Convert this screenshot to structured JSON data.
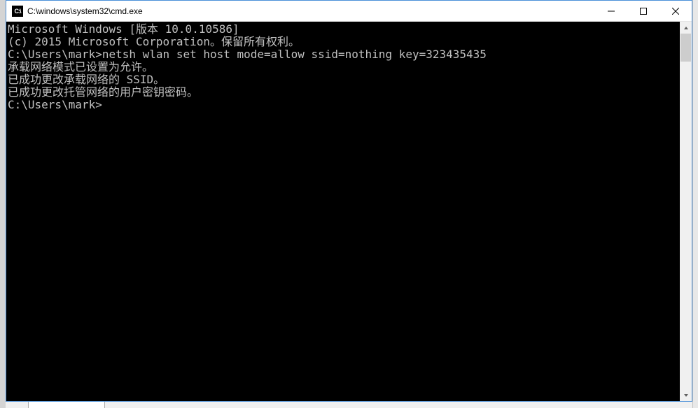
{
  "titlebar": {
    "icon_label": "C:\\",
    "title": "C:\\windows\\system32\\cmd.exe"
  },
  "terminal": {
    "line1": "Microsoft Windows [版本 10.0.10586]",
    "line2": "(c) 2015 Microsoft Corporation。保留所有权利。",
    "blank1": "",
    "prompt1": "C:\\Users\\mark>",
    "command1": "netsh wlan set host mode=allow ssid=nothing key=323435435",
    "resp1": "承载网络模式已设置为允许。",
    "resp2": "已成功更改承载网络的 SSID。",
    "resp3": "已成功更改托管网络的用户密钥密码。",
    "blank2": "",
    "blank3": "",
    "prompt2": "C:\\Users\\mark>"
  }
}
